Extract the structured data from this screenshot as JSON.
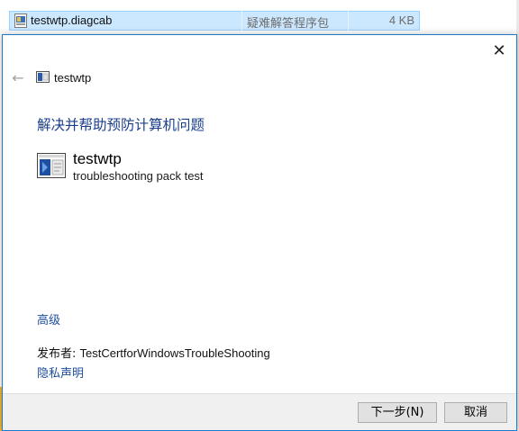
{
  "explorer": {
    "file_name": "testwtp.diagcab",
    "file_type": "疑难解答程序包",
    "file_size": "4 KB",
    "file_icon": "diagcab-file-icon"
  },
  "dialog": {
    "close_icon": "close-icon",
    "back_icon": "back-arrow-icon",
    "header_title": "testwtp",
    "heading": "解决并帮助预防计算机问题",
    "package": {
      "name": "testwtp",
      "description": "troubleshooting pack test"
    },
    "advanced_link": "高级",
    "publisher_label": "发布者: ",
    "publisher_value": "TestCertforWindowsTroubleShooting",
    "privacy_link": "隐私声明",
    "buttons": {
      "next": "下一步(N)",
      "cancel": "取消"
    }
  },
  "colors": {
    "heading": "#1a3e8c",
    "link": "#1e4e9a",
    "selection": "#cce8ff",
    "dialog_border": "#1e79c8"
  }
}
